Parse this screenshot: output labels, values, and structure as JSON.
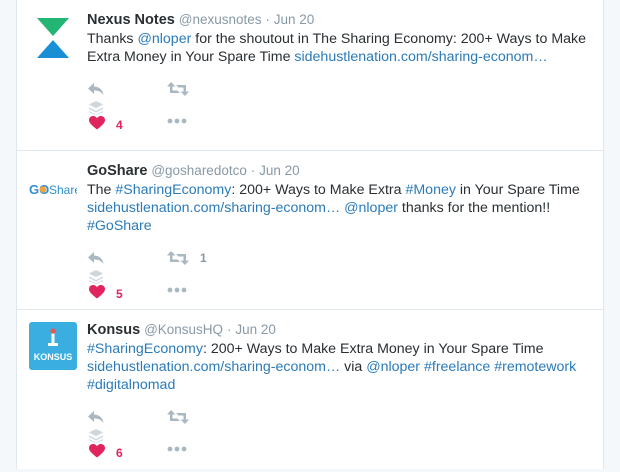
{
  "tweets": [
    {
      "name": "Nexus Notes",
      "handle": "@nexusnotes",
      "separator": "·",
      "date": "Jun 20",
      "segments": [
        {
          "text": "Thanks ",
          "type": "plain"
        },
        {
          "text": "@nloper",
          "type": "mention"
        },
        {
          "text": " for the shoutout in The Sharing Economy: 200+ Ways to Make Extra Money in Your Spare Time ",
          "type": "plain"
        },
        {
          "text": "sidehustlenation.com/sharing-econom…",
          "type": "link"
        }
      ],
      "retweet_count": "",
      "like_count": "4",
      "avatar": "nexus-logo"
    },
    {
      "name": "GoShare",
      "handle": "@gosharedotco",
      "separator": "·",
      "date": "Jun 20",
      "segments": [
        {
          "text": "The ",
          "type": "plain"
        },
        {
          "text": "#SharingEconomy",
          "type": "hashtag"
        },
        {
          "text": ": 200+ Ways to Make Extra ",
          "type": "plain"
        },
        {
          "text": "#Money",
          "type": "hashtag"
        },
        {
          "text": " in Your Spare Time ",
          "type": "plain"
        },
        {
          "text": "sidehustlenation.com/sharing-econom…",
          "type": "link"
        },
        {
          "text": " ",
          "type": "plain"
        },
        {
          "text": "@nloper",
          "type": "mention"
        },
        {
          "text": " thanks for the mention!! ",
          "type": "plain"
        },
        {
          "text": "#GoShare",
          "type": "hashtag"
        }
      ],
      "retweet_count": "1",
      "like_count": "5",
      "avatar": "goshare-logo",
      "avatar_text": {
        "go": "GO",
        "share": "Share"
      }
    },
    {
      "name": "Konsus",
      "handle": "@KonsusHQ",
      "separator": "·",
      "date": "Jun 20",
      "segments": [
        {
          "text": "#SharingEconomy",
          "type": "hashtag"
        },
        {
          "text": ": 200+ Ways to Make Extra Money in Your Spare Time ",
          "type": "plain"
        },
        {
          "text": "sidehustlenation.com/sharing-econom…",
          "type": "link"
        },
        {
          "text": " via ",
          "type": "plain"
        },
        {
          "text": "@nloper",
          "type": "mention"
        },
        {
          "text": " ",
          "type": "plain"
        },
        {
          "text": "#freelance",
          "type": "hashtag"
        },
        {
          "text": " ",
          "type": "plain"
        },
        {
          "text": "#remotework",
          "type": "hashtag"
        },
        {
          "text": " ",
          "type": "plain"
        },
        {
          "text": "#digitalnomad",
          "type": "hashtag"
        }
      ],
      "retweet_count": "",
      "like_count": "6",
      "avatar": "konsus-logo",
      "avatar_text": {
        "word": "KONSUS"
      }
    }
  ],
  "icons": {
    "reply": "reply-icon",
    "retweet": "retweet-icon",
    "stack": "stack-icon",
    "like": "heart-icon",
    "more": "more-icon"
  },
  "colors": {
    "link": "#2b7bb9",
    "meta": "#8899a6",
    "like": "#e0245e",
    "nexus_green": "#23b573",
    "nexus_blue": "#1b8fd6",
    "konsus_bg": "#3aaee0"
  }
}
